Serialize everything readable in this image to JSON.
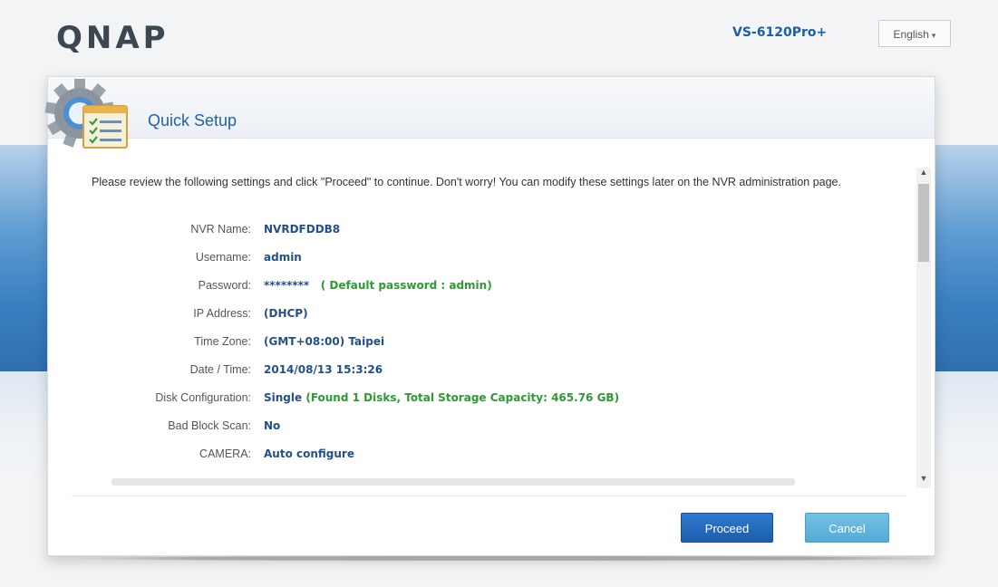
{
  "header": {
    "logo_text": "QNAP",
    "model": "VS-6120Pro+",
    "language": "English"
  },
  "dialog": {
    "title": "Quick Setup",
    "intro": "Please review the following settings and click \"Proceed\" to continue. Don't worry! You can modify these settings later on the NVR administration page.",
    "settings": [
      {
        "label": "NVR Name:",
        "value": "NVRDFDDB8",
        "note": ""
      },
      {
        "label": "Username:",
        "value": "admin",
        "note": ""
      },
      {
        "label": "Password:",
        "value": "********",
        "note": "( Default password  :  admin)"
      },
      {
        "label": "IP Address:",
        "value": "(DHCP)",
        "note": ""
      },
      {
        "label": "Time Zone:",
        "value": "(GMT+08:00) Taipei",
        "note": ""
      },
      {
        "label": "Date / Time:",
        "value": "2014/08/13 15:3:26",
        "note": ""
      },
      {
        "label": "Disk Configuration:",
        "value": "Single",
        "note": "(Found 1 Disks, Total Storage Capacity: 465.76 GB)"
      },
      {
        "label": "Bad Block Scan:",
        "value": "No",
        "note": ""
      },
      {
        "label": "CAMERA:",
        "value": "Auto configure",
        "note": ""
      }
    ],
    "buttons": {
      "proceed": "Proceed",
      "cancel": "Cancel"
    }
  },
  "colors": {
    "accent": "#1f63ad",
    "value_text": "#23508a",
    "note_green": "#2e9a33",
    "proceed_button": "#1b5eab",
    "cancel_button": "#55abd6"
  },
  "icons": [
    "setup-gear-checklist-icon",
    "chevron-down-icon",
    "chevron-up-icon",
    "chevron-down-icon"
  ]
}
